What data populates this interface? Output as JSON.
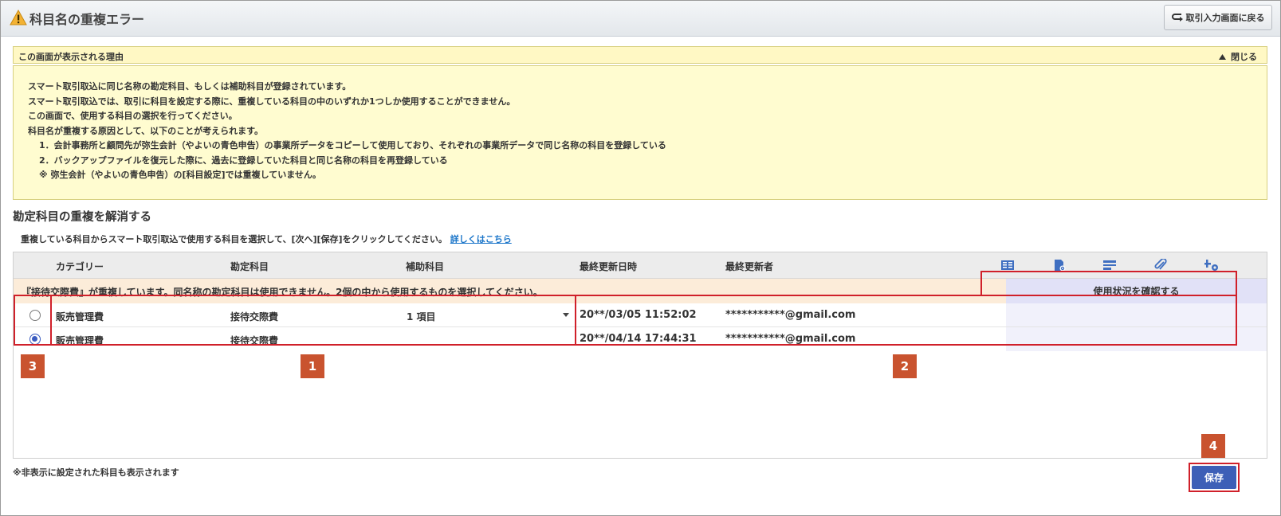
{
  "window": {
    "title": "科目名の重複エラー",
    "back_button": "取引入力画面に戻る"
  },
  "reason": {
    "header": "この画面が表示される理由",
    "close_label": "閉じる",
    "lines": [
      "スマート取引取込に同じ名称の勘定科目、もしくは補助科目が登録されています。",
      "スマート取引取込では、取引に科目を設定する際に、重複している科目の中のいずれか1つしか使用することができません。",
      "この画面で、使用する科目の選択を行ってください。",
      "科目名が重複する原因として、以下のことが考えられます。",
      "1．会計事務所と顧問先が弥生会計（やよいの青色申告）の事業所データをコピーして使用しており、それぞれの事業所データで同じ名称の科目を登録している",
      "2．バックアップファイルを復元した際に、過去に登録していた科目と同じ名称の科目を再登録している",
      "※ 弥生会計（やよいの青色申告）の[科目設定]では重複していません。"
    ]
  },
  "section": {
    "title": "勘定科目の重複を解消する",
    "instruction": "重複している科目からスマート取引取込で使用する科目を選択して、[次へ][保存]をクリックしてください。",
    "link": "詳しくはこちら"
  },
  "table": {
    "headers": {
      "category": "カテゴリー",
      "account": "勘定科目",
      "sub_account": "補助科目",
      "updated_at": "最終更新日時",
      "updated_by": "最終更新者"
    },
    "header_icons": [
      "ledger-icon",
      "document-settings-icon",
      "card-icon",
      "attachment-icon",
      "add-settings-icon"
    ],
    "warning": "『接待交際費』が重複しています。同名称の勘定科目は使用できません。2個の中から使用するものを選択してください。",
    "usage_button": "使用状況を確認する",
    "rows": [
      {
        "selected": false,
        "category": "販売管理費",
        "account": "接待交際費",
        "sub_account": "1 項目",
        "updated_at": "20**/03/05 11:52:02",
        "updated_by": "***********@gmail.com"
      },
      {
        "selected": true,
        "category": "販売管理費",
        "account": "接待交際費",
        "sub_account": "",
        "updated_at": "20**/04/14 17:44:31",
        "updated_by": "***********@gmail.com"
      }
    ]
  },
  "annotations": {
    "badge1": "1",
    "badge2": "2",
    "badge3": "3",
    "badge4": "4",
    "highlight_color": "#d0202a",
    "badge_color": "#c9532f"
  },
  "footer": {
    "note": "※非表示に設定された科目も表示されます",
    "save_button": "保存"
  }
}
